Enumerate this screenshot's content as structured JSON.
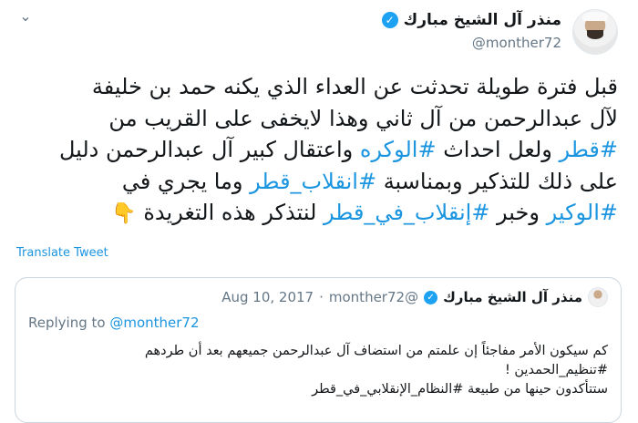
{
  "tweet": {
    "display_name": "منذر آل الشيخ مبارك",
    "handle": "@monther72",
    "lines": [
      [
        {
          "t": "قبل فترة طويلة تحدثت عن العداء الذي يكنه حمد بن خليفة",
          "tag": false
        }
      ],
      [
        {
          "t": "لآل عبدالرحمن من آل ثاني وهذا لايخفى على القريب من",
          "tag": false
        }
      ],
      [
        {
          "t": "#قطر",
          "tag": true
        },
        {
          "t": " ولعل احداث ",
          "tag": false
        },
        {
          "t": "#الوكره",
          "tag": true
        },
        {
          "t": " واعتقال كبير آل عبدالرحمن دليل",
          "tag": false
        }
      ],
      [
        {
          "t": "على ذلك للتذكير وبمناسبة ",
          "tag": false
        },
        {
          "t": "#انقلاب_قطر",
          "tag": true
        },
        {
          "t": " وما يجري في",
          "tag": false
        }
      ],
      [
        {
          "t": "#الوكير",
          "tag": true
        },
        {
          "t": " وخبر ",
          "tag": false
        },
        {
          "t": "#إنقلاب_في_قطر",
          "tag": true
        },
        {
          "t": " لنتذكر هذه التغريدة ",
          "tag": false
        },
        {
          "t": "👇",
          "tag": false
        }
      ]
    ],
    "translate_label": "Translate Tweet"
  },
  "quoted": {
    "display_name": "منذر آل الشيخ مبارك",
    "handle": "@monther72",
    "separator": "·",
    "date": "Aug 10, 2017",
    "replying_prefix": "Replying to ",
    "replying_handle": "@monther72",
    "lines": [
      [
        {
          "t": "كم سيكون الأمر مفاجئاً إن علمتم من استضاف آل عبدالرحمن جميعهم بعد أن طردهم",
          "tag": false
        }
      ],
      [
        {
          "t": "#تنظيم_الحمدين",
          "tag": false
        },
        {
          "t": " !",
          "tag": false
        }
      ],
      [
        {
          "t": "ستتأكدون حينها من طبيعة ",
          "tag": false
        },
        {
          "t": "#النظام_الإنقلابي_في_قطر",
          "tag": false
        }
      ]
    ]
  },
  "colors": {
    "link": "#1b95e0",
    "verified": "#1da1f2",
    "muted": "#657786"
  },
  "icons": {
    "verified": "verified-badge-icon",
    "menu": "chevron-down-icon",
    "point_down": "backhand-index-pointing-down-emoji"
  }
}
